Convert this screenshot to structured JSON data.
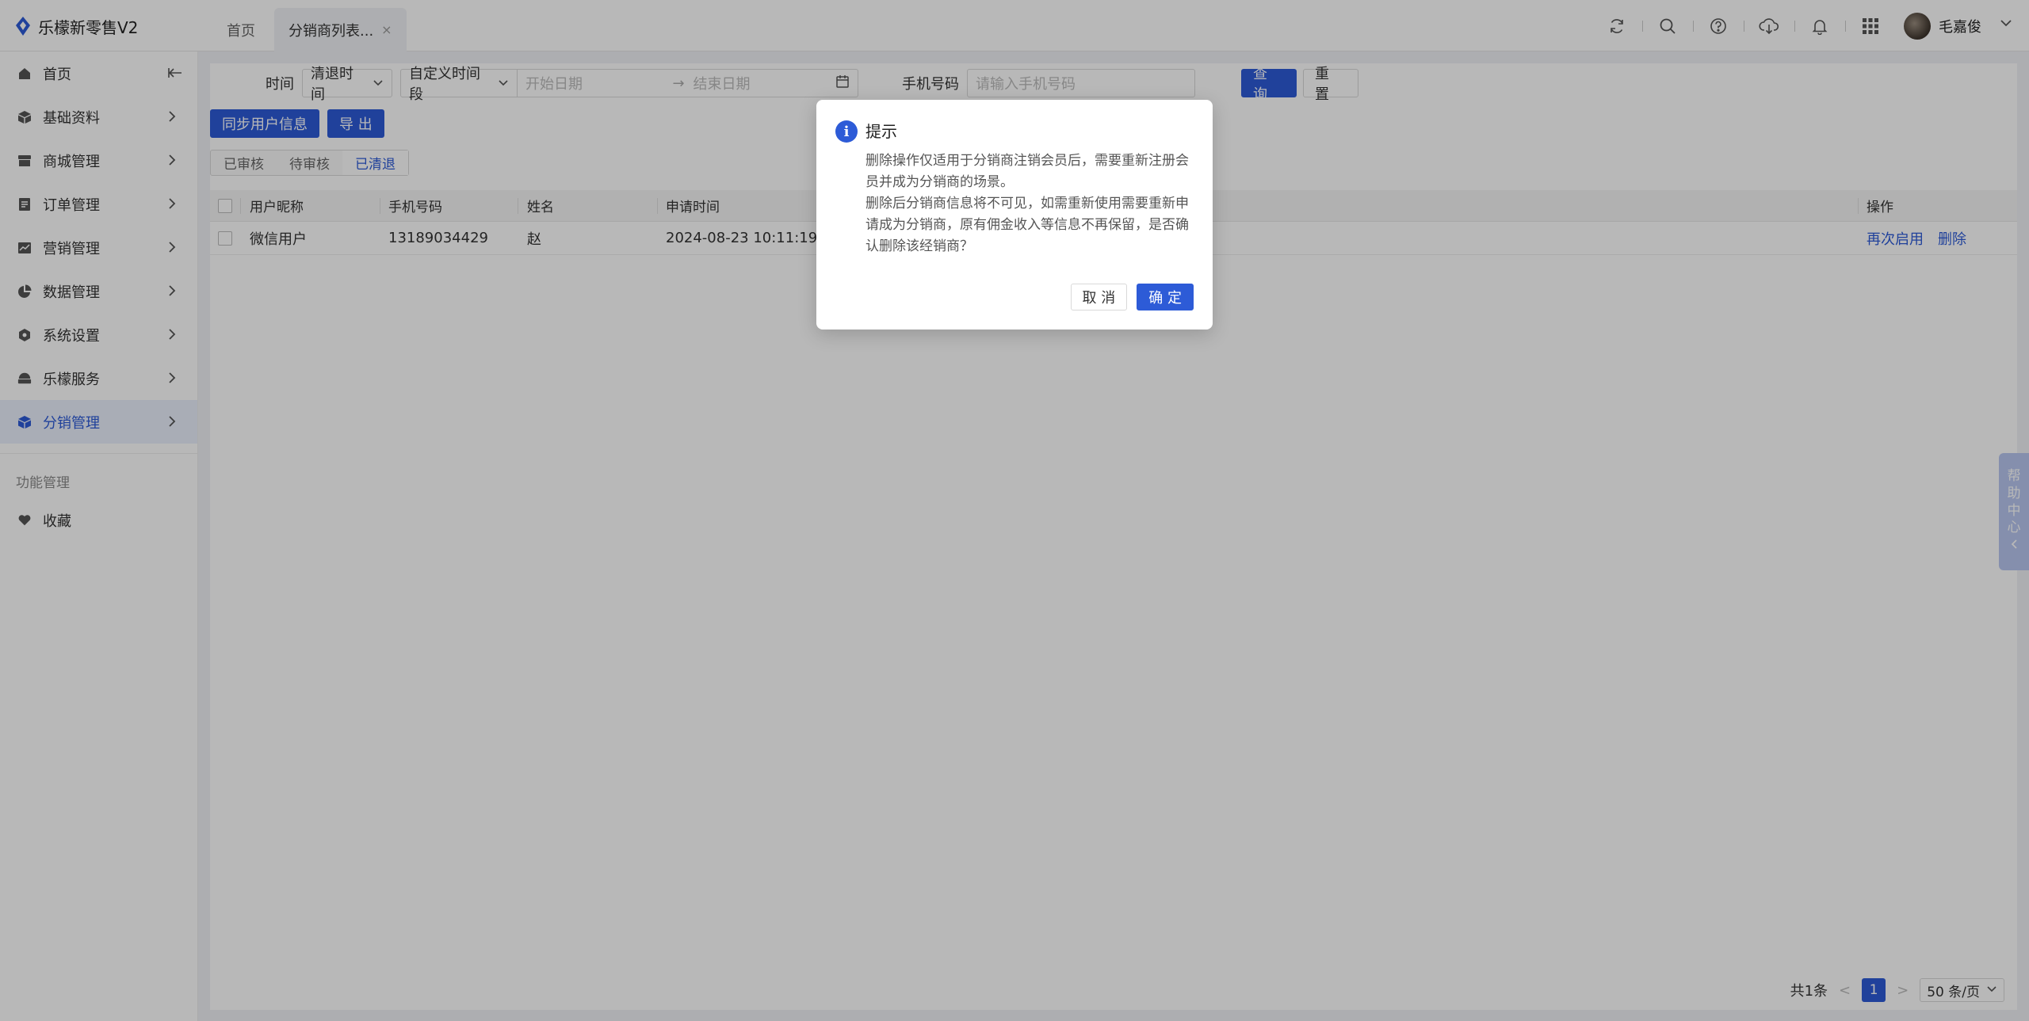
{
  "app": {
    "title": "乐檬新零售V2"
  },
  "tabs": [
    {
      "label": "首页"
    },
    {
      "label": "分销商列表...",
      "close": "×"
    }
  ],
  "user": {
    "name": "毛嘉俊"
  },
  "sidebar": {
    "items": [
      {
        "label": "首页"
      },
      {
        "label": "基础资料"
      },
      {
        "label": "商城管理"
      },
      {
        "label": "订单管理"
      },
      {
        "label": "营销管理"
      },
      {
        "label": "数据管理"
      },
      {
        "label": "系统设置"
      },
      {
        "label": "乐檬服务"
      },
      {
        "label": "分销管理"
      }
    ],
    "section_label": "功能管理",
    "favorites_label": "收藏"
  },
  "filters": {
    "time_label": "时间",
    "time_type": "清退时间",
    "range_type": "自定义时间段",
    "start_placeholder": "开始日期",
    "range_arrow": "→",
    "end_placeholder": "结束日期",
    "phone_label": "手机号码",
    "phone_placeholder": "请输入手机号码",
    "query_label": "查 询",
    "reset_label": "重 置"
  },
  "actions": {
    "sync_label": "同步用户信息",
    "export_label": "导 出"
  },
  "status_tabs": [
    {
      "label": "已审核"
    },
    {
      "label": "待审核"
    },
    {
      "label": "已清退"
    }
  ],
  "table": {
    "headers": [
      "用户昵称",
      "手机号码",
      "姓名",
      "申请时间",
      "操作"
    ],
    "rows": [
      {
        "nickname": "微信用户",
        "phone": "13189034429",
        "name": "赵",
        "applied_at": "2024-08-23 10:11:19",
        "action_reenable": "再次启用",
        "action_delete": "删除"
      }
    ]
  },
  "pagination": {
    "total": "共1条",
    "current": "1",
    "page_size": "50 条/页"
  },
  "help_center": [
    "帮",
    "助",
    "中",
    "心"
  ],
  "modal": {
    "title": "提示",
    "line1": "删除操作仅适用于分销商注销会员后，需要重新注册会员并成为分销商的场景。",
    "line2": "删除后分销商信息将不可见，如需重新使用需要重新申请成为分销商，原有佣金收入等信息不再保留，是否确认删除该经销商？",
    "cancel_label": "取 消",
    "confirm_label": "确 定"
  },
  "colors": {
    "accent": "#2d5bd7",
    "overlay": "rgba(0,0,0,0.28)"
  },
  "icons": [
    "logo-icon",
    "refresh-icon",
    "search-icon",
    "help-icon",
    "download-icon",
    "bell-icon",
    "apps-grid-icon",
    "chevron-down-icon",
    "collapse-icon",
    "chevron-right-icon",
    "calendar-icon",
    "info-icon"
  ]
}
